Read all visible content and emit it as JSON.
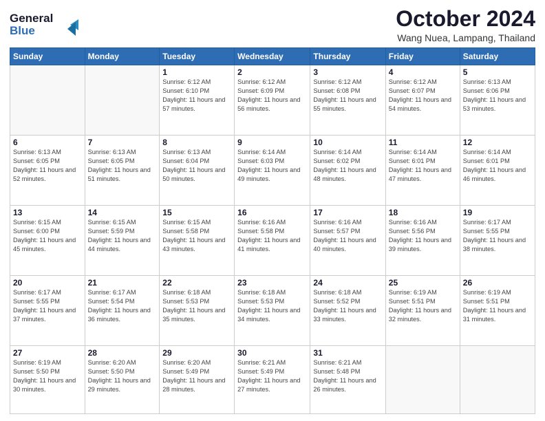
{
  "logo": {
    "line1": "General",
    "line2": "Blue"
  },
  "title": "October 2024",
  "location": "Wang Nuea, Lampang, Thailand",
  "days_of_week": [
    "Sunday",
    "Monday",
    "Tuesday",
    "Wednesday",
    "Thursday",
    "Friday",
    "Saturday"
  ],
  "weeks": [
    [
      {
        "day": "",
        "info": ""
      },
      {
        "day": "",
        "info": ""
      },
      {
        "day": "1",
        "sunrise": "6:12 AM",
        "sunset": "6:10 PM",
        "daylight": "11 hours and 57 minutes."
      },
      {
        "day": "2",
        "sunrise": "6:12 AM",
        "sunset": "6:09 PM",
        "daylight": "11 hours and 56 minutes."
      },
      {
        "day": "3",
        "sunrise": "6:12 AM",
        "sunset": "6:08 PM",
        "daylight": "11 hours and 55 minutes."
      },
      {
        "day": "4",
        "sunrise": "6:12 AM",
        "sunset": "6:07 PM",
        "daylight": "11 hours and 54 minutes."
      },
      {
        "day": "5",
        "sunrise": "6:13 AM",
        "sunset": "6:06 PM",
        "daylight": "11 hours and 53 minutes."
      }
    ],
    [
      {
        "day": "6",
        "sunrise": "6:13 AM",
        "sunset": "6:05 PM",
        "daylight": "11 hours and 52 minutes."
      },
      {
        "day": "7",
        "sunrise": "6:13 AM",
        "sunset": "6:05 PM",
        "daylight": "11 hours and 51 minutes."
      },
      {
        "day": "8",
        "sunrise": "6:13 AM",
        "sunset": "6:04 PM",
        "daylight": "11 hours and 50 minutes."
      },
      {
        "day": "9",
        "sunrise": "6:14 AM",
        "sunset": "6:03 PM",
        "daylight": "11 hours and 49 minutes."
      },
      {
        "day": "10",
        "sunrise": "6:14 AM",
        "sunset": "6:02 PM",
        "daylight": "11 hours and 48 minutes."
      },
      {
        "day": "11",
        "sunrise": "6:14 AM",
        "sunset": "6:01 PM",
        "daylight": "11 hours and 47 minutes."
      },
      {
        "day": "12",
        "sunrise": "6:14 AM",
        "sunset": "6:01 PM",
        "daylight": "11 hours and 46 minutes."
      }
    ],
    [
      {
        "day": "13",
        "sunrise": "6:15 AM",
        "sunset": "6:00 PM",
        "daylight": "11 hours and 45 minutes."
      },
      {
        "day": "14",
        "sunrise": "6:15 AM",
        "sunset": "5:59 PM",
        "daylight": "11 hours and 44 minutes."
      },
      {
        "day": "15",
        "sunrise": "6:15 AM",
        "sunset": "5:58 PM",
        "daylight": "11 hours and 43 minutes."
      },
      {
        "day": "16",
        "sunrise": "6:16 AM",
        "sunset": "5:58 PM",
        "daylight": "11 hours and 41 minutes."
      },
      {
        "day": "17",
        "sunrise": "6:16 AM",
        "sunset": "5:57 PM",
        "daylight": "11 hours and 40 minutes."
      },
      {
        "day": "18",
        "sunrise": "6:16 AM",
        "sunset": "5:56 PM",
        "daylight": "11 hours and 39 minutes."
      },
      {
        "day": "19",
        "sunrise": "6:17 AM",
        "sunset": "5:55 PM",
        "daylight": "11 hours and 38 minutes."
      }
    ],
    [
      {
        "day": "20",
        "sunrise": "6:17 AM",
        "sunset": "5:55 PM",
        "daylight": "11 hours and 37 minutes."
      },
      {
        "day": "21",
        "sunrise": "6:17 AM",
        "sunset": "5:54 PM",
        "daylight": "11 hours and 36 minutes."
      },
      {
        "day": "22",
        "sunrise": "6:18 AM",
        "sunset": "5:53 PM",
        "daylight": "11 hours and 35 minutes."
      },
      {
        "day": "23",
        "sunrise": "6:18 AM",
        "sunset": "5:53 PM",
        "daylight": "11 hours and 34 minutes."
      },
      {
        "day": "24",
        "sunrise": "6:18 AM",
        "sunset": "5:52 PM",
        "daylight": "11 hours and 33 minutes."
      },
      {
        "day": "25",
        "sunrise": "6:19 AM",
        "sunset": "5:51 PM",
        "daylight": "11 hours and 32 minutes."
      },
      {
        "day": "26",
        "sunrise": "6:19 AM",
        "sunset": "5:51 PM",
        "daylight": "11 hours and 31 minutes."
      }
    ],
    [
      {
        "day": "27",
        "sunrise": "6:19 AM",
        "sunset": "5:50 PM",
        "daylight": "11 hours and 30 minutes."
      },
      {
        "day": "28",
        "sunrise": "6:20 AM",
        "sunset": "5:50 PM",
        "daylight": "11 hours and 29 minutes."
      },
      {
        "day": "29",
        "sunrise": "6:20 AM",
        "sunset": "5:49 PM",
        "daylight": "11 hours and 28 minutes."
      },
      {
        "day": "30",
        "sunrise": "6:21 AM",
        "sunset": "5:49 PM",
        "daylight": "11 hours and 27 minutes."
      },
      {
        "day": "31",
        "sunrise": "6:21 AM",
        "sunset": "5:48 PM",
        "daylight": "11 hours and 26 minutes."
      },
      {
        "day": "",
        "info": ""
      },
      {
        "day": "",
        "info": ""
      }
    ]
  ]
}
